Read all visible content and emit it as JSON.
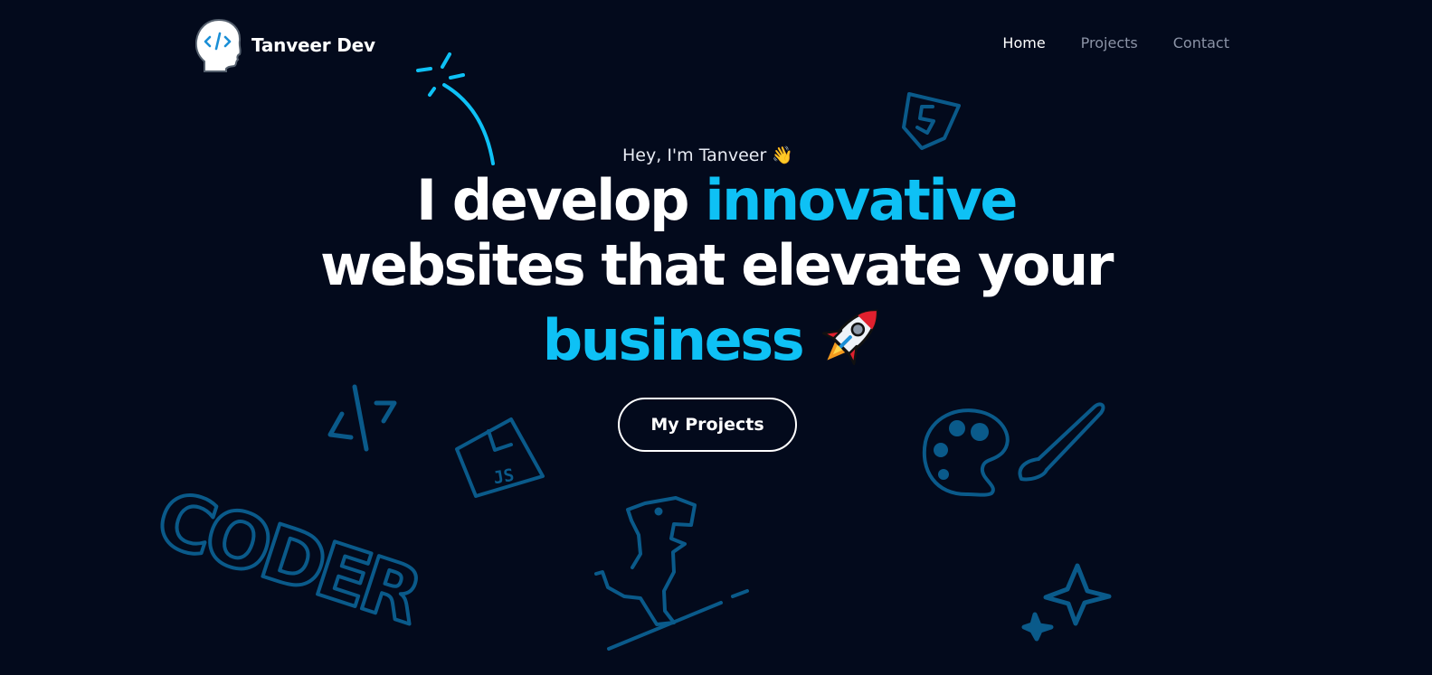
{
  "brand": {
    "name": "Tanveer Dev",
    "logo_icon": "code-head-icon"
  },
  "nav": {
    "items": [
      {
        "label": "Home",
        "active": true
      },
      {
        "label": "Projects",
        "active": false
      },
      {
        "label": "Contact",
        "active": false
      }
    ]
  },
  "hero": {
    "greeting": "Hey, I'm Tanveer 👋",
    "headline_part1": "I develop ",
    "headline_accent1": "innovative",
    "headline_part2": "websites that elevate your",
    "headline_accent2": "business",
    "rocket_icon": "rocket-icon",
    "cta_label": "My Projects"
  },
  "doodles": {
    "bubble_text": "CODER",
    "js_file_text": "JS",
    "icons": [
      "sparkle-icon",
      "html5-icon",
      "code-brackets-icon",
      "js-file-icon",
      "dino-icon",
      "palette-icon",
      "paintbrush-icon",
      "star-icon"
    ]
  },
  "colors": {
    "background": "#030a1c",
    "accent": "#0ec1f5",
    "doodle": "#0a5a8a",
    "text": "#ffffff",
    "nav_muted": "#8b93a6"
  }
}
